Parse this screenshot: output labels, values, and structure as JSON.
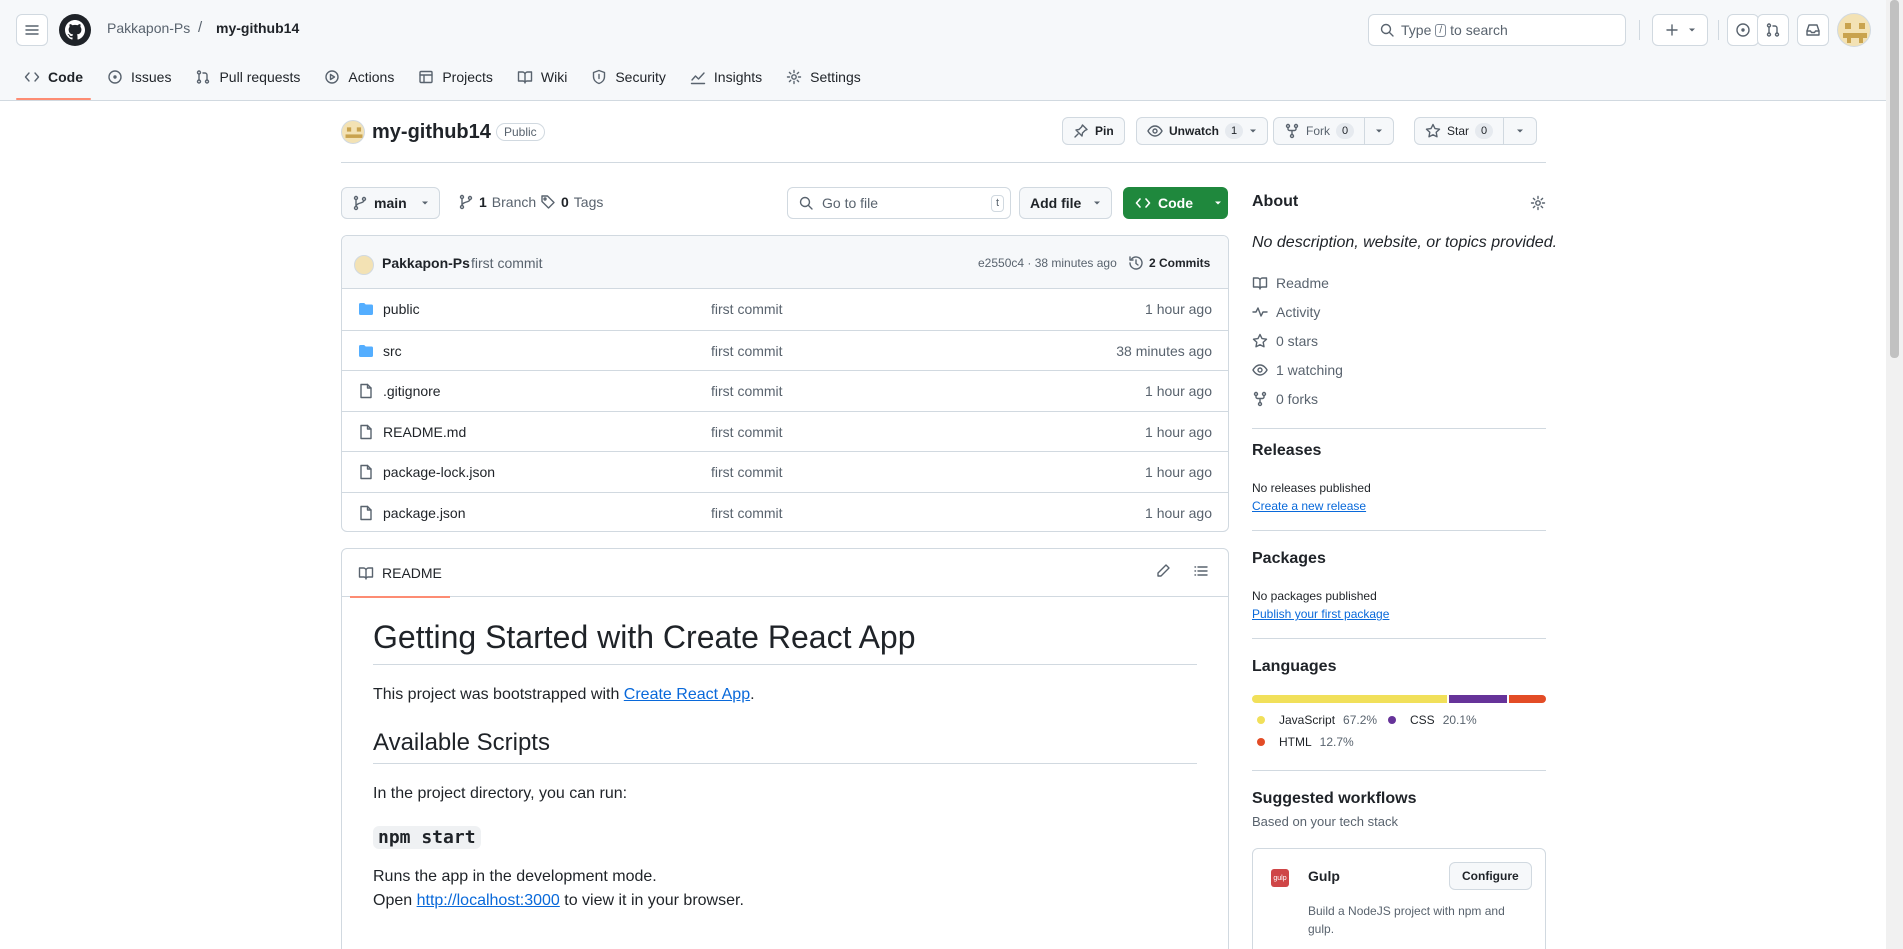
{
  "header": {
    "owner": "Pakkapon-Ps",
    "separator": "/",
    "repo": "my-github14",
    "search": {
      "prefix": "Type",
      "key": "/",
      "suffix": "to search"
    },
    "icons": [
      "menu-icon",
      "github-logo",
      "search-icon",
      "plus-icon",
      "issues-icon",
      "pull-request-icon",
      "inbox-icon"
    ]
  },
  "tabs": [
    {
      "label": "Code",
      "icon": "code-icon",
      "active": true
    },
    {
      "label": "Issues",
      "icon": "issue-icon"
    },
    {
      "label": "Pull requests",
      "icon": "pull-request-icon"
    },
    {
      "label": "Actions",
      "icon": "play-icon"
    },
    {
      "label": "Projects",
      "icon": "table-icon"
    },
    {
      "label": "Wiki",
      "icon": "book-icon"
    },
    {
      "label": "Security",
      "icon": "shield-icon"
    },
    {
      "label": "Insights",
      "icon": "graph-icon"
    },
    {
      "label": "Settings",
      "icon": "gear-icon"
    }
  ],
  "repo": {
    "name": "my-github14",
    "visibility": "Public",
    "pin_label": "Pin",
    "watch_label": "Unwatch",
    "watch_count": "1",
    "fork_label": "Fork",
    "fork_count": "0",
    "star_label": "Star",
    "star_count": "0"
  },
  "filebar": {
    "branch": "main",
    "branches_count": "1",
    "branches_label": "Branch",
    "tags_count": "0",
    "tags_label": "Tags",
    "go_to_file": "Go to file",
    "go_to_file_key": "t",
    "add_file": "Add file",
    "code_button": "Code"
  },
  "last_commit": {
    "author": "Pakkapon-Ps",
    "message": "first commit",
    "sha_time": "e2550c4 · 38 minutes ago",
    "commits_label": "2 Commits"
  },
  "files": [
    {
      "name": "public",
      "type": "dir",
      "message": "first commit",
      "age": "1 hour ago"
    },
    {
      "name": "src",
      "type": "dir",
      "message": "first commit",
      "age": "38 minutes ago"
    },
    {
      "name": ".gitignore",
      "type": "file",
      "message": "first commit",
      "age": "1 hour ago"
    },
    {
      "name": "README.md",
      "type": "file",
      "message": "first commit",
      "age": "1 hour ago"
    },
    {
      "name": "package-lock.json",
      "type": "file",
      "message": "first commit",
      "age": "1 hour ago"
    },
    {
      "name": "package.json",
      "type": "file",
      "message": "first commit",
      "age": "1 hour ago"
    }
  ],
  "readme": {
    "tab_label": "README",
    "h1": "Getting Started with Create React App",
    "p1_prefix": "This project was bootstrapped with ",
    "p1_link": "Create React App",
    "p1_suffix": ".",
    "h2": "Available Scripts",
    "p2": "In the project directory, you can run:",
    "h3": "npm start",
    "p3": "Runs the app in the development mode.",
    "p4_prefix": "Open ",
    "p4_link": "http://localhost:3000",
    "p4_suffix": " to view it in your browser."
  },
  "about": {
    "heading": "About",
    "description": "No description, website, or topics provided.",
    "items": [
      {
        "label": "Readme",
        "icon": "book-icon"
      },
      {
        "label": "Activity",
        "icon": "pulse-icon"
      },
      {
        "label": "0 stars",
        "icon": "star-icon"
      },
      {
        "label": "1 watching",
        "icon": "eye-icon"
      },
      {
        "label": "0 forks",
        "icon": "fork-icon"
      }
    ]
  },
  "releases": {
    "heading": "Releases",
    "text": "No releases published",
    "link": "Create a new release"
  },
  "packages": {
    "heading": "Packages",
    "text": "No packages published",
    "link": "Publish your first package"
  },
  "languages": {
    "heading": "Languages",
    "items": [
      {
        "name": "JavaScript",
        "percent": "67.2%",
        "value": 67.2,
        "color": "#f1e05a"
      },
      {
        "name": "CSS",
        "percent": "20.1%",
        "value": 20.1,
        "color": "#663399"
      },
      {
        "name": "HTML",
        "percent": "12.7%",
        "value": 12.7,
        "color": "#e34c26"
      }
    ]
  },
  "workflows": {
    "heading": "Suggested workflows",
    "subheading": "Based on your tech stack",
    "card": {
      "name": "Gulp",
      "logo_text": "gulp",
      "description": "Build a NodeJS project with npm and gulp.",
      "button": "Configure"
    }
  },
  "colors": {
    "accent": "#fd8c73",
    "primary_button": "#1f883d",
    "link": "#0969da",
    "folder": "#54aeff"
  }
}
